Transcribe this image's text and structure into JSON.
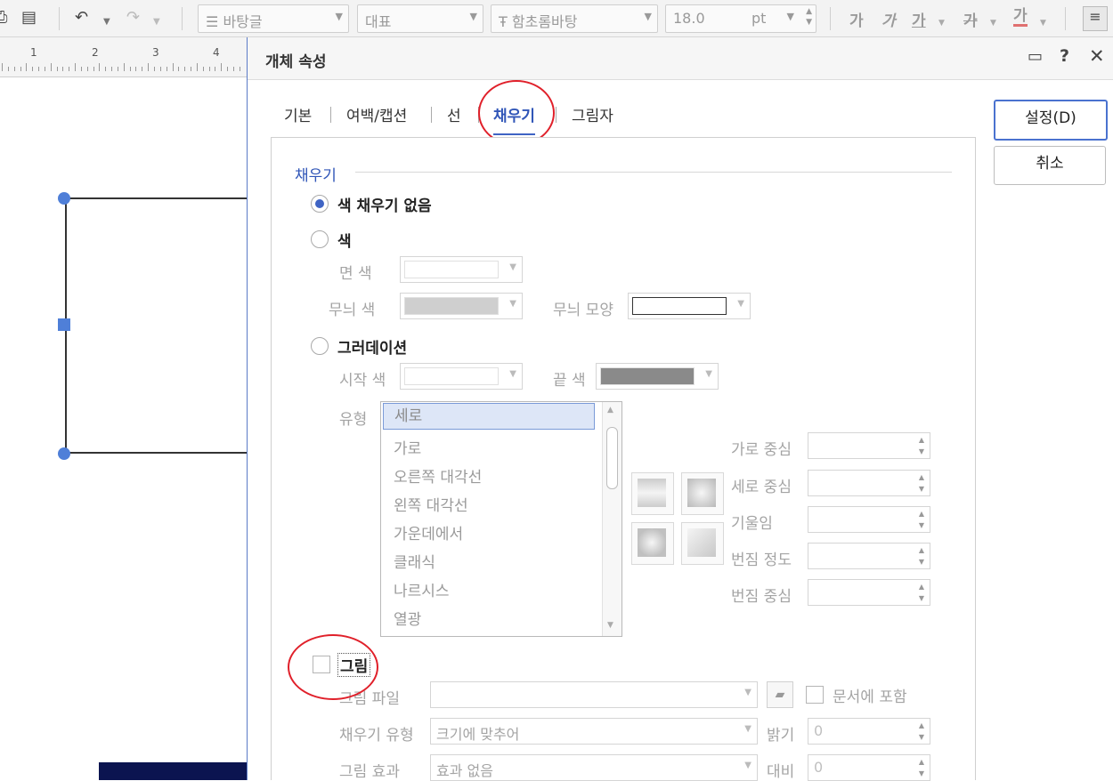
{
  "toolbar": {
    "style_combo": "바탕글",
    "lang_combo": "대표",
    "font_combo": "함초롬바탕",
    "size_value": "18.0",
    "size_unit": "pt",
    "bold": "가",
    "italic": "가",
    "underline": "가",
    "strike": "가",
    "color_text": "가"
  },
  "ruler": {
    "numbers": [
      "1",
      "2",
      "3",
      "4"
    ]
  },
  "dialog": {
    "title": "개체 속성",
    "tabs": [
      "기본",
      "여백/캡션",
      "선",
      "채우기",
      "그림자"
    ],
    "active_tab": "채우기",
    "buttons": {
      "ok": "설정(D)",
      "cancel": "취소"
    }
  },
  "fill": {
    "section_title": "채우기",
    "no_fill": "색 채우기 없음",
    "color": "색",
    "face_color_label": "면 색",
    "pattern_color_label": "무늬 색",
    "pattern_shape_label": "무늬 모양",
    "gradation": "그러데이션",
    "start_color_label": "시작 색",
    "end_color_label": "끝 색",
    "type_label": "유형",
    "types": [
      "세로",
      "가로",
      "오른쪽 대각선",
      "왼쪽 대각선",
      "가운데에서",
      "클래식",
      "나르시스",
      "열광"
    ],
    "selected_type": "세로",
    "h_center_label": "가로 중심",
    "v_center_label": "세로 중심",
    "tilt_label": "기울임",
    "blur_level_label": "번짐 정도",
    "blur_center_label": "번짐 중심",
    "picture": "그림",
    "picture_file_label": "그림 파일",
    "include_in_doc": "문서에 포함",
    "fill_type_label": "채우기 유형",
    "fill_type_value": "크기에 맞추어",
    "brightness_label": "밝기",
    "brightness_value": "0",
    "picture_effect_label": "그림 효과",
    "picture_effect_value": "효과 없음",
    "contrast_label": "대비",
    "contrast_value": "0"
  },
  "colors": {
    "accent": "#3f64c4",
    "annotation": "#e0202a",
    "handle": "#4f7fd8"
  }
}
